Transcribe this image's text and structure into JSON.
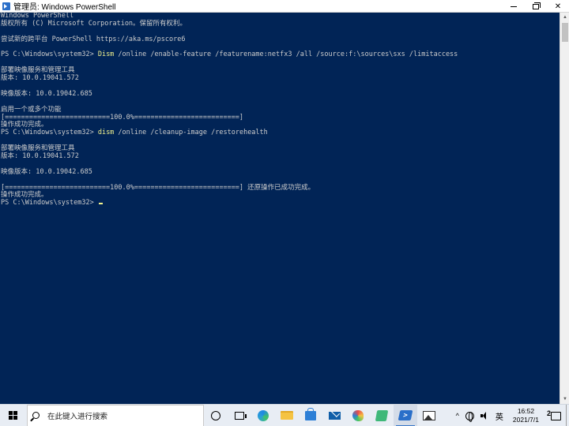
{
  "window": {
    "title": "管理员: Windows PowerShell",
    "minimize_icon": "minimize-icon",
    "maximize_icon": "restore-icon",
    "close_glyph": "✕"
  },
  "console": {
    "lines": [
      {
        "text": "Windows PowerShell"
      },
      {
        "text": "版权所有 (C) Microsoft Corporation。保留所有权利。"
      },
      {
        "text": ""
      },
      {
        "text": "尝试新的跨平台 PowerShell https://aka.ms/pscore6"
      },
      {
        "text": ""
      },
      {
        "prompt": "PS C:\\Windows\\system32> ",
        "cmd": "Dism",
        "args": " /online /enable-feature /featurename:netfx3 /all /source:f:\\sources\\sxs /limitaccess"
      },
      {
        "text": ""
      },
      {
        "text": "部署映像服务和管理工具"
      },
      {
        "text": "版本: 10.0.19041.572"
      },
      {
        "text": ""
      },
      {
        "text": "映像版本: 10.0.19042.685"
      },
      {
        "text": ""
      },
      {
        "text": "启用一个或多个功能"
      },
      {
        "text": "[==========================100.0%==========================]"
      },
      {
        "text": "操作成功完成。"
      },
      {
        "prompt": "PS C:\\Windows\\system32> ",
        "cmd": "dism",
        "args": " /online /cleanup-image /restorehealth"
      },
      {
        "text": ""
      },
      {
        "text": "部署映像服务和管理工具"
      },
      {
        "text": "版本: 10.0.19041.572"
      },
      {
        "text": ""
      },
      {
        "text": "映像版本: 10.0.19042.685"
      },
      {
        "text": ""
      },
      {
        "text": "[==========================100.0%==========================] 还原操作已成功完成。"
      },
      {
        "text": "操作成功完成。"
      },
      {
        "prompt": "PS C:\\Windows\\system32> ",
        "cmd": "",
        "args": "",
        "cursor": true
      }
    ]
  },
  "taskbar": {
    "search_placeholder": "在此键入进行搜索",
    "pinned": [
      {
        "name": "cortana-icon",
        "cls": "cortana"
      },
      {
        "name": "task-view-icon",
        "cls": "taskview"
      },
      {
        "name": "edge-icon",
        "cls": "edge"
      },
      {
        "name": "file-explorer-icon",
        "cls": "folder"
      },
      {
        "name": "store-icon",
        "cls": "store"
      },
      {
        "name": "mail-icon",
        "cls": "mail"
      },
      {
        "name": "paint-icon",
        "cls": "paint"
      },
      {
        "name": "sticky-notes-icon",
        "cls": "notes"
      },
      {
        "name": "powershell-icon",
        "cls": "ps-icon",
        "active": true
      },
      {
        "name": "photos-icon",
        "cls": "photos"
      }
    ],
    "tray": {
      "chevron": "^",
      "ime": "英",
      "time": "16:52",
      "date": "2021/7/1",
      "notification_count": "2"
    }
  }
}
